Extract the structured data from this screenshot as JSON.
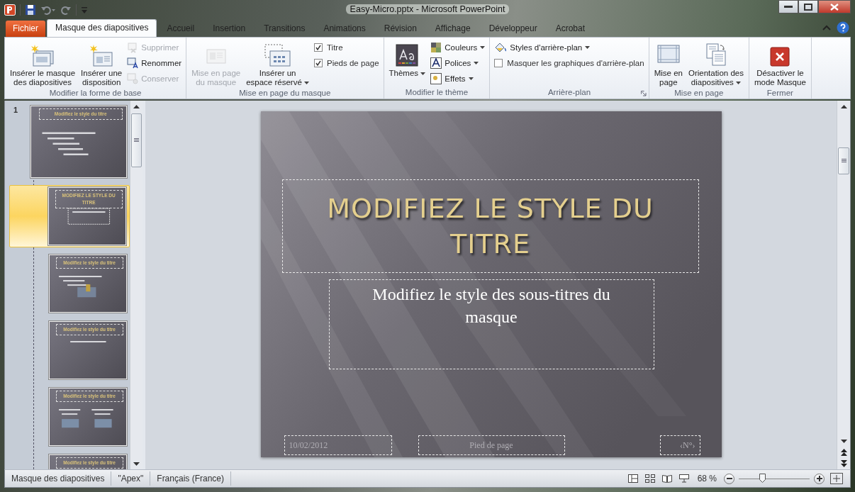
{
  "window": {
    "title": "Easy-Micro.pptx - Microsoft PowerPoint"
  },
  "ribbon_tabs": [
    {
      "label": "Fichier",
      "kind": "file",
      "selected": false
    },
    {
      "label": "Masque des diapositives",
      "kind": "tab",
      "selected": true
    },
    {
      "label": "Accueil",
      "kind": "tab",
      "selected": false
    },
    {
      "label": "Insertion",
      "kind": "tab",
      "selected": false
    },
    {
      "label": "Transitions",
      "kind": "tab",
      "selected": false
    },
    {
      "label": "Animations",
      "kind": "tab",
      "selected": false
    },
    {
      "label": "Révision",
      "kind": "tab",
      "selected": false
    },
    {
      "label": "Affichage",
      "kind": "tab",
      "selected": false
    },
    {
      "label": "Développeur",
      "kind": "tab",
      "selected": false
    },
    {
      "label": "Acrobat",
      "kind": "tab",
      "selected": false
    }
  ],
  "ribbon_groups": [
    {
      "label": "Modifier la forme de base",
      "launcher": false,
      "items": [
        {
          "kind": "large",
          "label": "Insérer le masque\ndes diapositives",
          "disabled": false,
          "dropdown": false
        },
        {
          "kind": "large",
          "label": "Insérer une\ndisposition",
          "disabled": false,
          "dropdown": false
        },
        {
          "kind": "stack",
          "items": [
            {
              "kind": "small",
              "label": "Supprimer",
              "disabled": true,
              "dropdown": false
            },
            {
              "kind": "small",
              "label": "Renommer",
              "disabled": false,
              "dropdown": false
            },
            {
              "kind": "small",
              "label": "Conserver",
              "disabled": true,
              "dropdown": false
            }
          ]
        }
      ]
    },
    {
      "label": "Mise en page du masque",
      "launcher": false,
      "items": [
        {
          "kind": "large",
          "label": "Mise en page\ndu masque",
          "disabled": true,
          "dropdown": false
        },
        {
          "kind": "large",
          "label": "Insérer un\nespace réservé",
          "disabled": false,
          "dropdown": true
        },
        {
          "kind": "stack",
          "items": [
            {
              "kind": "check",
              "label": "Titre",
              "checked": true
            },
            {
              "kind": "check",
              "label": "Pieds de page",
              "checked": true
            }
          ]
        }
      ]
    },
    {
      "label": "Modifier le thème",
      "launcher": false,
      "items": [
        {
          "kind": "large",
          "label": "Thèmes",
          "disabled": false,
          "dropdown": true
        },
        {
          "kind": "stack",
          "items": [
            {
              "kind": "small",
              "label": "Couleurs",
              "disabled": false,
              "dropdown": true
            },
            {
              "kind": "small",
              "label": "Polices",
              "disabled": false,
              "dropdown": true
            },
            {
              "kind": "small",
              "label": "Effets",
              "disabled": false,
              "dropdown": true
            }
          ]
        }
      ]
    },
    {
      "label": "Arrière-plan",
      "launcher": true,
      "items": [
        {
          "kind": "stack",
          "items": [
            {
              "kind": "small",
              "label": "Styles d'arrière-plan",
              "disabled": false,
              "dropdown": true
            },
            {
              "kind": "check",
              "label": "Masquer les graphiques d'arrière-plan",
              "checked": false
            }
          ]
        }
      ]
    },
    {
      "label": "Mise en page",
      "launcher": false,
      "items": [
        {
          "kind": "large",
          "label": "Mise en\npage",
          "disabled": false,
          "dropdown": false
        },
        {
          "kind": "large",
          "label": "Orientation des\ndiapositives",
          "disabled": false,
          "dropdown": true
        }
      ]
    },
    {
      "label": "Fermer",
      "launcher": false,
      "items": [
        {
          "kind": "large",
          "label": "Désactiver le\nmode Masque",
          "disabled": false,
          "dropdown": false
        }
      ]
    }
  ],
  "thumbnails": [
    {
      "number": "1",
      "kind": "master",
      "title": "Modifiez le style du titre",
      "selected": false
    },
    {
      "kind": "title",
      "title": "MODIFIEZ LE STYLE DU TITRE",
      "selected": true
    },
    {
      "kind": "content",
      "title": "Modifiez le style du titre",
      "selected": false
    },
    {
      "kind": "section",
      "title": "Modifiez le style du titre",
      "selected": false
    },
    {
      "kind": "two",
      "title": "Modifiez le style du titre",
      "selected": false
    },
    {
      "kind": "cut",
      "title": "Modifiez le style du titre",
      "selected": false
    }
  ],
  "slide": {
    "title": "MODIFIEZ LE STYLE DU TITRE",
    "subtitle": "Modifiez le style des sous-titres du masque",
    "date": "10/02/2012",
    "footer": "Pied de page",
    "number": "‹N°›"
  },
  "status_bar": {
    "items": [
      "Masque des diapositives",
      "\"Apex\"",
      "Français (France)"
    ],
    "zoom": "68 %",
    "zoom_slider": {
      "level": 0.34
    }
  }
}
